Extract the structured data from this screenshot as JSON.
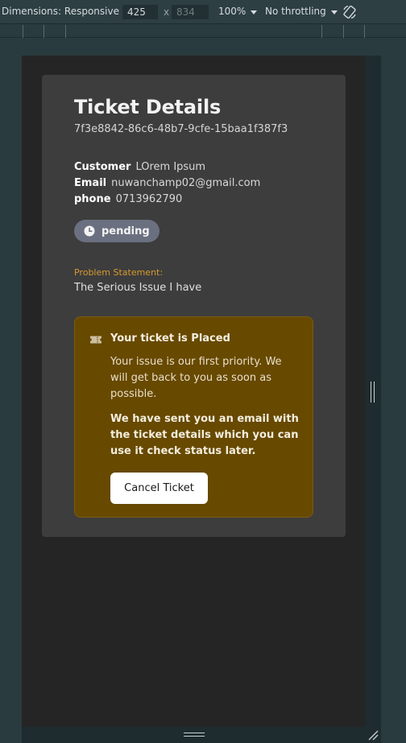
{
  "devtools": {
    "dimensions_label": "Dimensions: Responsive",
    "width": "425",
    "x": "x",
    "height": "834",
    "zoom": "100%",
    "throttling": "No throttling"
  },
  "ticket": {
    "title": "Ticket Details",
    "id": "7f3e8842-86c6-48b7-9cfe-15baa1f387f3",
    "customer_label": "Customer",
    "customer_value": "LOrem Ipsum",
    "email_label": "Email",
    "email_value": "nuwanchamp02@gmail.com",
    "phone_label": "phone",
    "phone_value": "0713962790",
    "status": "pending",
    "problem_label": "Problem Statement:",
    "problem_text": "The Serious Issue I have"
  },
  "alert": {
    "title": "Your ticket is Placed",
    "message": "Your issue is our first priority. We will get back to you as soon as possible.",
    "strong_message": "We have sent you an email with the ticket details which you can use it check status later.",
    "cancel_label": "Cancel Ticket"
  },
  "colors": {
    "card_bg": "#3d3d3d",
    "alert_bg": "#674900",
    "status_bg": "#6b7080",
    "accent": "#d69a2e"
  }
}
